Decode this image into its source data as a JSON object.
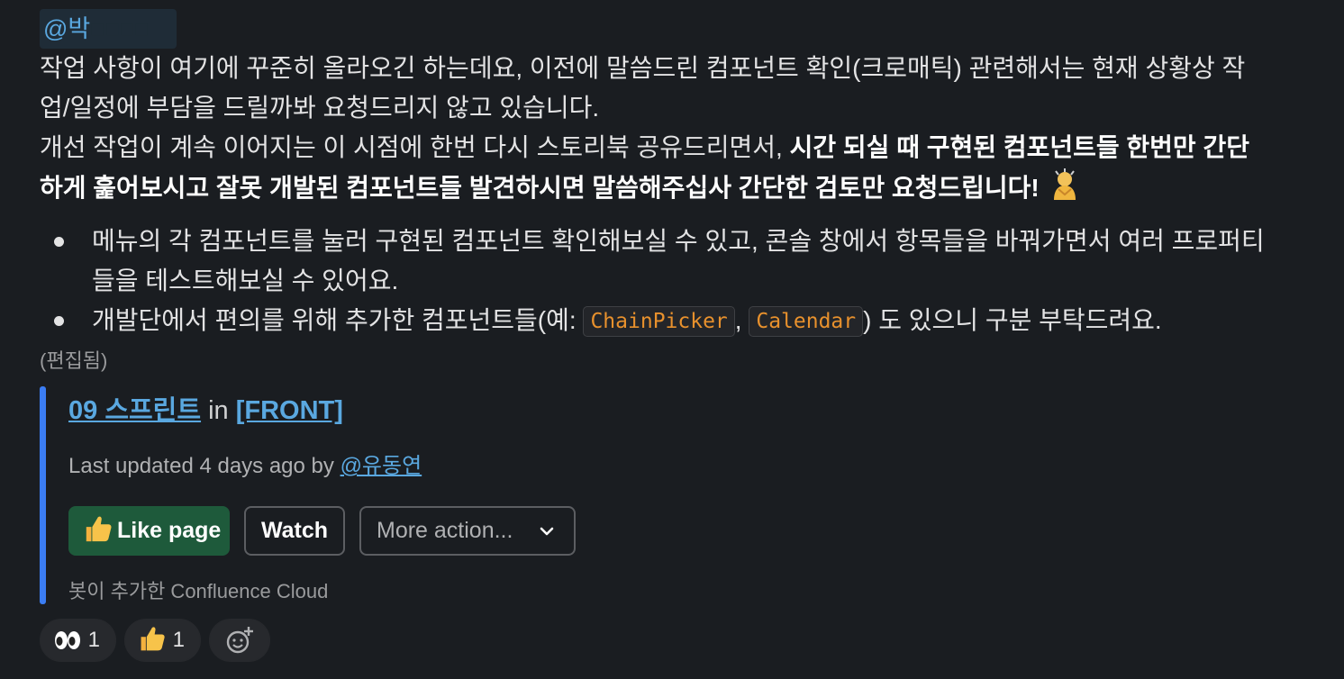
{
  "mention": "@박",
  "message": {
    "line1": "작업 사항이 여기에 꾸준히 올라오긴 하는데요, 이전에 말씀드린 컴포넌트 확인(크로매틱) 관련해서는 현재 상황상 작",
    "line2": "업/일정에 부담을 드릴까봐 요청드리지 않고 있습니다.",
    "line3_plain": "개선 작업이 계속 이어지는 이 시점에 한번 다시 스토리북 공유드리면서, ",
    "line3_bold": "시간 되실 때 구현된 컴포넌트들 한번만 간단",
    "line4_bold": "하게 훑어보시고 잘못 개발된 컴포넌트들 발견하시면 말씀해주십사 간단한 검토만 요청드립니다!",
    "emoji": "person-bowing-emoji"
  },
  "bullets": {
    "item1_line1": "메뉴의 각 컴포넌트를 눌러 구현된 컴포넌트 확인해보실 수 있고, 콘솔 창에서 항목들을 바꿔가면서 여러 프로퍼티",
    "item1_line2": "들을 테스트해보실 수 있어요.",
    "item2_before": "개발단에서 편의를 위해 추가한 컴포넌트들(예: ",
    "item2_code1": "ChainPicker",
    "item2_sep": ", ",
    "item2_code2": "Calendar",
    "item2_after": ") 도 있으니 구분 부탁드려요."
  },
  "edited_label": "(편집됨)",
  "attachment": {
    "page_link": "09 스프린트",
    "in_text": " in ",
    "space_link": "[FRONT]",
    "meta_prefix": "Last updated 4 days ago by ",
    "author_link": "@유동연",
    "like_label": "Like page",
    "watch_label": "Watch",
    "more_label": "More action...",
    "bot_note": "봇이 추가한 Confluence Cloud",
    "accent_color": "#3b7df3"
  },
  "reactions": [
    {
      "icon": "eyes-emoji",
      "count": "1"
    },
    {
      "icon": "thumbs-up-emoji",
      "count": "1"
    },
    {
      "icon": "add-reaction-icon"
    }
  ]
}
